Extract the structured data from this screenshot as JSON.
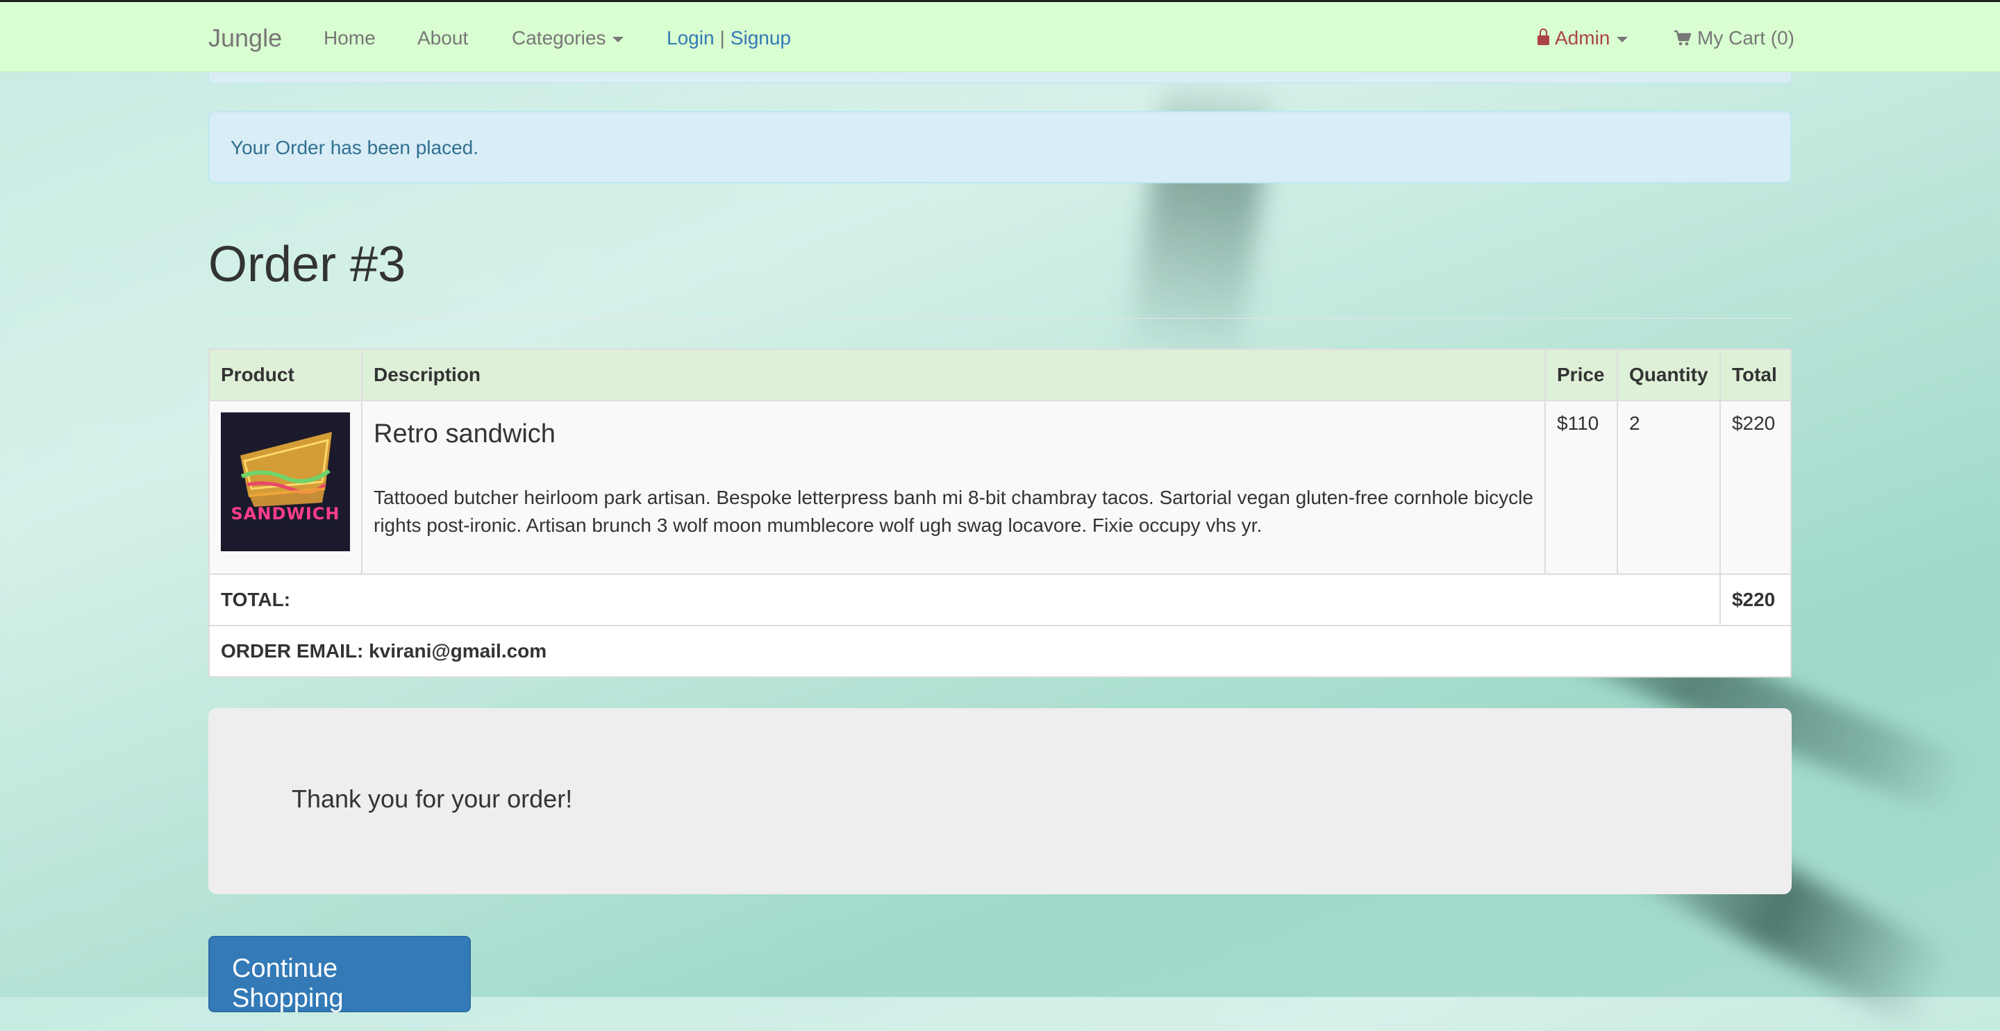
{
  "navbar": {
    "brand": "Jungle",
    "home": "Home",
    "about": "About",
    "categories": "Categories",
    "login": "Login",
    "separator": "|",
    "signup": "Signup",
    "admin": "Admin",
    "cart": "My Cart (0)"
  },
  "alert": {
    "message": "Your Order has been placed."
  },
  "page": {
    "title": "Order #3"
  },
  "table": {
    "headers": [
      "Product",
      "Description",
      "Price",
      "Quantity",
      "Total"
    ],
    "items": [
      {
        "image_label": "SANDWICH",
        "name": "Retro sandwich",
        "description": "Tattooed butcher heirloom park artisan. Bespoke letterpress banh mi 8-bit chambray tacos. Sartorial vegan gluten-free cornhole bicycle rights post-ironic. Artisan brunch 3 wolf moon mumblecore wolf ugh swag locavore. Fixie occupy vhs yr.",
        "price": "$110",
        "quantity": "2",
        "total": "$220"
      }
    ],
    "total_label": "TOTAL:",
    "total_value": "$220",
    "email_line": "ORDER EMAIL: kvirani@gmail.com"
  },
  "jumbotron": {
    "message": "Thank you for your order!"
  },
  "button": {
    "label": "Continue Shopping"
  },
  "colors": {
    "navbar_bg": "#d9fed1",
    "link_blue": "#337ab7",
    "admin_red": "#a94442",
    "alert_bg": "#d9edf7",
    "table_header_bg": "#dff0d8",
    "button_bg": "#337ab7"
  },
  "icons": {
    "admin": "lock-icon",
    "cart": "shopping-cart-icon",
    "dropdown": "caret-down-icon"
  }
}
